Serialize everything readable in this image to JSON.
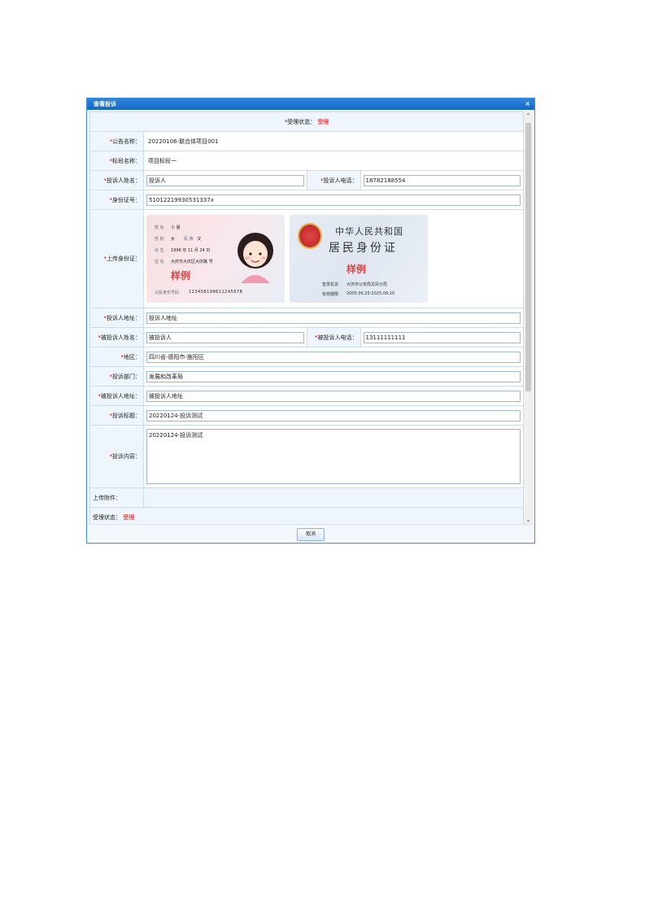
{
  "dialog": {
    "title": "查看投诉",
    "close_label": "×"
  },
  "status_top": {
    "label": "受理状态：",
    "value": "受理"
  },
  "fields": {
    "announcement_name": {
      "label": "公告名称：",
      "value": "20220106-联合体项目001"
    },
    "section_name": {
      "label": "标段名称：",
      "value": "项目标段一"
    },
    "complainant_name": {
      "label": "投诉人姓名：",
      "value": "投诉人"
    },
    "complainant_phone": {
      "label": "投诉人电话：",
      "value": "18782188554"
    },
    "id_number": {
      "label": "身份证号：",
      "value": "51012219930531337x"
    },
    "upload_id": {
      "label": "上传身份证："
    },
    "complainant_address": {
      "label": "投诉人地址：",
      "value": "投诉人地址"
    },
    "respondent_name": {
      "label": "被投诉人姓名：",
      "value": "被投诉人"
    },
    "respondent_phone": {
      "label": "被投诉人电话：",
      "value": "13111111111"
    },
    "region": {
      "label": "地区：",
      "value": "四川省-德阳市-旌阳区"
    },
    "department": {
      "label": "投诉部门：",
      "value": "发展和改革局"
    },
    "respondent_address": {
      "label": "被投诉人地址：",
      "value": "被投诉人地址"
    },
    "complaint_title": {
      "label": "投诉标题：",
      "value": "20220124-投诉测试"
    },
    "complaint_content": {
      "label": "投诉内容：",
      "value": "20220124-投诉测试"
    },
    "attachments": {
      "label": "上传附件：",
      "value": ""
    },
    "status_bottom": {
      "label": "受理状态：",
      "value": "受理"
    }
  },
  "id_card_front": {
    "name_label": "姓 名",
    "name_value": "小 晨",
    "gender_label": "性 别",
    "gender_value": "女",
    "ethnic_label": "民 族",
    "ethnic_value": "汉",
    "birth_label": "出 生",
    "birth_value": "1996 年 11 月 24 日",
    "address_label": "住 址",
    "address_value": "大庆市大庆区大庆路 号",
    "stamp": "样例",
    "id_label": "公民身份号码",
    "id_value": "123456199611245678"
  },
  "id_card_back": {
    "title_line1": "中华人民共和国",
    "title_line2": "居民身份证",
    "stamp": "样例",
    "authority_label": "签发机关",
    "authority_value": "大庆市公安局龙凤分局",
    "validity_label": "有效期限",
    "validity_value": "2005.09.20-2025.09.20"
  },
  "footer": {
    "cancel_label": "取消"
  },
  "colors": {
    "titlebar": "#1a72cf",
    "required": "#e00000",
    "label_bg": "#eef5fc",
    "border": "#c9dcef"
  }
}
